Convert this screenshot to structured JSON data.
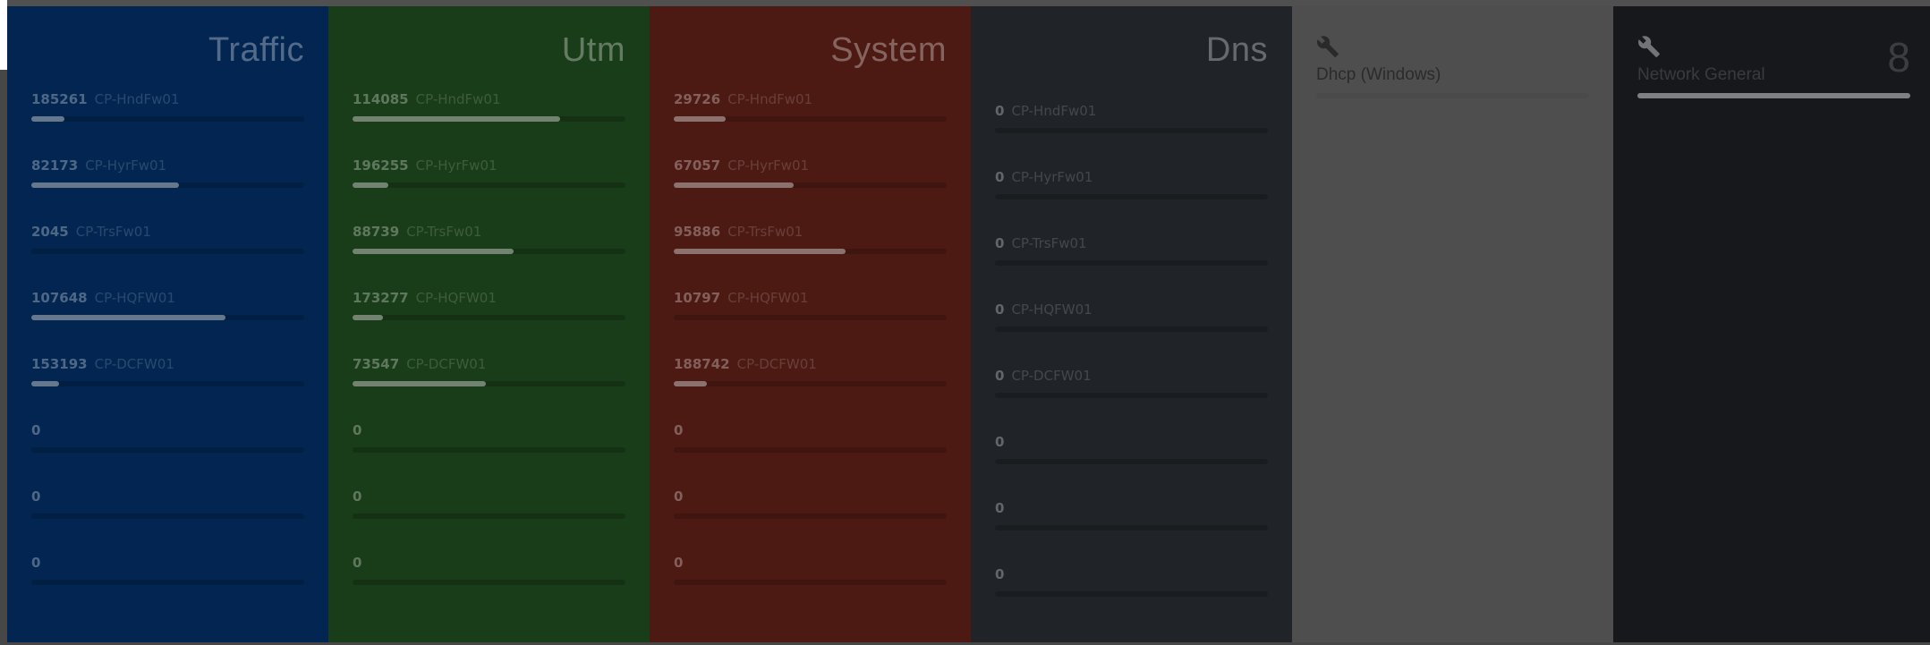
{
  "panels": {
    "traffic": {
      "title": "Traffic",
      "color": "#022651",
      "rows": [
        {
          "value": "185261",
          "name": "CP-HndFw01",
          "fill": 0.12
        },
        {
          "value": "82173",
          "name": "CP-HyrFw01",
          "fill": 0.54
        },
        {
          "value": "2045",
          "name": "CP-TrsFw01",
          "fill": 0.0
        },
        {
          "value": "107648",
          "name": "CP-HQFW01",
          "fill": 0.71
        },
        {
          "value": "153193",
          "name": "CP-DCFW01",
          "fill": 0.1
        },
        {
          "value": "0",
          "name": "",
          "fill": 0.0
        },
        {
          "value": "0",
          "name": "",
          "fill": 0.0
        },
        {
          "value": "0",
          "name": "",
          "fill": 0.0
        }
      ]
    },
    "utm": {
      "title": "Utm",
      "color": "#193d18",
      "rows": [
        {
          "value": "114085",
          "name": "CP-HndFw01",
          "fill": 0.76
        },
        {
          "value": "196255",
          "name": "CP-HyrFw01",
          "fill": 0.13
        },
        {
          "value": "88739",
          "name": "CP-TrsFw01",
          "fill": 0.59
        },
        {
          "value": "173277",
          "name": "CP-HQFW01",
          "fill": 0.11
        },
        {
          "value": "73547",
          "name": "CP-DCFW01",
          "fill": 0.49
        },
        {
          "value": "0",
          "name": "",
          "fill": 0.0
        },
        {
          "value": "0",
          "name": "",
          "fill": 0.0
        },
        {
          "value": "0",
          "name": "",
          "fill": 0.0
        }
      ]
    },
    "system": {
      "title": "System",
      "color": "#4c1a13",
      "rows": [
        {
          "value": "29726",
          "name": "CP-HndFw01",
          "fill": 0.19
        },
        {
          "value": "67057",
          "name": "CP-HyrFw01",
          "fill": 0.44
        },
        {
          "value": "95886",
          "name": "CP-TrsFw01",
          "fill": 0.63
        },
        {
          "value": "10797",
          "name": "CP-HQFW01",
          "fill": 0.0
        },
        {
          "value": "188742",
          "name": "CP-DCFW01",
          "fill": 0.12
        },
        {
          "value": "0",
          "name": "",
          "fill": 0.0
        },
        {
          "value": "0",
          "name": "",
          "fill": 0.0
        },
        {
          "value": "0",
          "name": "",
          "fill": 0.0
        }
      ]
    },
    "dns": {
      "title": "Dns",
      "color": "#202428",
      "rows": [
        {
          "value": "0",
          "name": "CP-HndFw01",
          "fill": 0.0
        },
        {
          "value": "0",
          "name": "CP-HyrFw01",
          "fill": 0.0
        },
        {
          "value": "0",
          "name": "CP-TrsFw01",
          "fill": 0.0
        },
        {
          "value": "0",
          "name": "CP-HQFW01",
          "fill": 0.0
        },
        {
          "value": "0",
          "name": "CP-DCFW01",
          "fill": 0.0
        },
        {
          "value": "0",
          "name": "",
          "fill": 0.0
        },
        {
          "value": "0",
          "name": "",
          "fill": 0.0
        },
        {
          "value": "0",
          "name": "",
          "fill": 0.0
        }
      ]
    }
  },
  "tiles": {
    "dhcp": {
      "label": "Dhcp (Windows)",
      "icon": "wrench-icon",
      "color": "#4e4e4e"
    },
    "network": {
      "label": "Network General",
      "icon": "wrench-icon",
      "count": "8",
      "color": "#16181c"
    }
  }
}
